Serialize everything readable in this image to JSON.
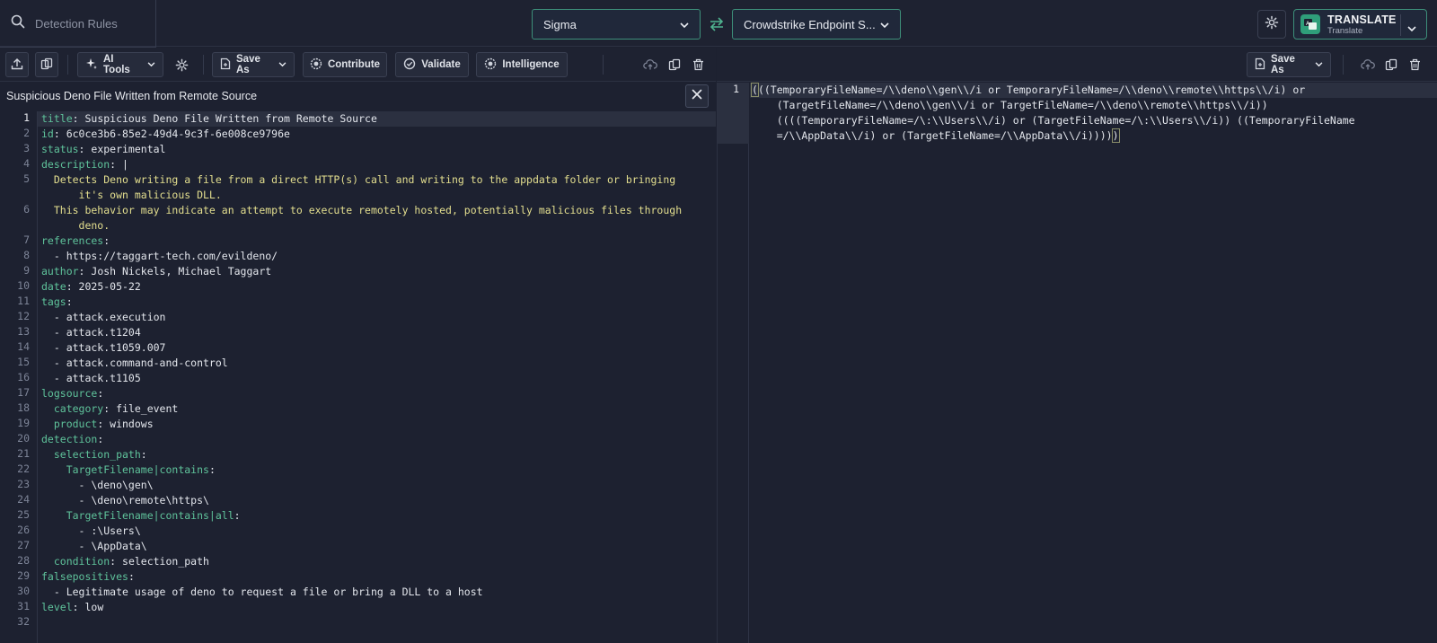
{
  "search": {
    "placeholder": "Detection Rules"
  },
  "source_dropdown": {
    "value": "Sigma"
  },
  "target_dropdown": {
    "value": "Crowdstrike Endpoint S..."
  },
  "translate_button": {
    "label": "TRANSLATE",
    "sublabel": "Translate"
  },
  "left_toolbar": {
    "ai_tools": "AI Tools",
    "save_as": "Save As",
    "contribute": "Contribute",
    "validate": "Validate",
    "intelligence": "Intelligence"
  },
  "right_toolbar": {
    "save_as": "Save As"
  },
  "rule_title": "Suspicious Deno File Written from Remote Source",
  "editor": {
    "line_numbers": [
      "1",
      "2",
      "3",
      "4",
      "5",
      "",
      "6",
      "",
      "7",
      "8",
      "9",
      "10",
      "11",
      "12",
      "13",
      "14",
      "15",
      "16",
      "17",
      "18",
      "19",
      "20",
      "21",
      "22",
      "23",
      "24",
      "25",
      "26",
      "27",
      "28",
      "29",
      "30",
      "31",
      "32"
    ],
    "lines": {
      "l1_key": "title",
      "l1_val": ": Suspicious Deno File Written from Remote Source",
      "l2_key": "id",
      "l2_val": ": 6c0ce3b6-85e2-49d4-9c3f-6e008ce9796e",
      "l3_key": "status",
      "l3_val": ": experimental",
      "l4_key": "description",
      "l4_val": ": |",
      "l5a": "  Detects Deno writing a file from a direct HTTP(s) call and writing to the appdata folder or bringing",
      "l5b": "      it's own malicious DLL.",
      "l6a": "  This behavior may indicate an attempt to execute remotely hosted, potentially malicious files through",
      "l6b": "      deno.",
      "l7_key": "references",
      "l7_val": ":",
      "l8": "  - https://taggart-tech.com/evildeno/",
      "l9_key": "author",
      "l9_val": ": Josh Nickels, Michael Taggart",
      "l10_key": "date",
      "l10_val": ": 2025-05-22",
      "l11_key": "tags",
      "l11_val": ":",
      "l12": "  - attack.execution",
      "l13": "  - attack.t1204",
      "l14": "  - attack.t1059.007",
      "l15": "  - attack.command-and-control",
      "l16": "  - attack.t1105",
      "l17_key": "logsource",
      "l17_val": ":",
      "l18_key": "  category",
      "l18_val": ": file_event",
      "l19_key": "  product",
      "l19_val": ": windows",
      "l20_key": "detection",
      "l20_val": ":",
      "l21_key": "  selection_path",
      "l21_val": ":",
      "l22_key": "    TargetFilename|contains",
      "l22_val": ":",
      "l23": "      - \\deno\\gen\\",
      "l24": "      - \\deno\\remote\\https\\",
      "l25_key": "    TargetFilename|contains|all",
      "l25_val": ":",
      "l26": "      - :\\Users\\",
      "l27": "      - \\AppData\\",
      "l28_key": "  condition",
      "l28_val": ": selection_path",
      "l29_key": "falsepositives",
      "l29_val": ":",
      "l30": "  - Legitimate usage of deno to request a file or bring a DLL to a host",
      "l31_key": "level",
      "l31_val": ": low"
    }
  },
  "output": {
    "line_number": "1",
    "open_paren": "(",
    "line1_rest": "((TemporaryFileName=/\\\\deno\\\\gen\\\\/i or TemporaryFileName=/\\\\deno\\\\remote\\\\https\\\\/i) or",
    "line2": "    (TargetFileName=/\\\\deno\\\\gen\\\\/i or TargetFileName=/\\\\deno\\\\remote\\\\https\\\\/i))",
    "line3": "    ((((TemporaryFileName=/\\:\\\\Users\\\\/i) or (TargetFileName=/\\:\\\\Users\\\\/i)) ((TemporaryFileName",
    "line4_rest": "    =/\\\\AppData\\\\/i) or (TargetFileName=/\\\\AppData\\\\/i))))",
    "close_paren": ")"
  }
}
